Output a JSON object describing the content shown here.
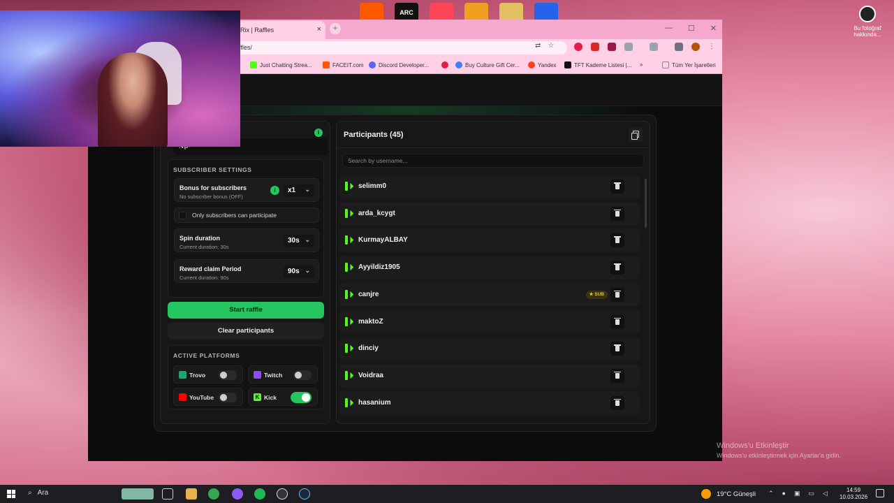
{
  "desktop": {
    "right_icon_label": "Bu fotoğraf hakkında...",
    "top_icons": [
      {
        "name": "fnatic-icon",
        "color": "#ff5900"
      },
      {
        "name": "arc-raiders-icon",
        "label": "ARC",
        "color": "#111111"
      },
      {
        "name": "valorant-icon",
        "color": "#fd4556"
      },
      {
        "name": "counter-strike-icon",
        "color": "#f0a020"
      },
      {
        "name": "game-icon",
        "color": "#e0c060"
      },
      {
        "name": "screenshot-tool-icon",
        "color": "#2563eb"
      }
    ],
    "watermark": {
      "line1": "Windows'u Etkinleştir",
      "line2": "Windows'u etkinleştirmek için Ayarlar'a gidin."
    }
  },
  "browser": {
    "tab_title": "Rix | Raffles",
    "address": "ffles/",
    "bookmarks": [
      {
        "label": "Just Chatting Strea...",
        "color": "#53fc18"
      },
      {
        "label": "FACEIT.com",
        "color": "#ff5500"
      },
      {
        "label": "Discord Developer...",
        "color": "#5865f2"
      },
      {
        "label": "",
        "color": "#e11d48"
      },
      {
        "label": "Buy Culture Gift Cer...",
        "color": "#3b82f6"
      },
      {
        "label": "Yandex",
        "color": "#fc3f1d"
      },
      {
        "label": "TFT Kademe Listesi |...",
        "color": "#111111"
      },
      {
        "label": "»",
        "color": ""
      },
      {
        "label": "Tüm Yer İşaretleri",
        "color": "#888888"
      }
    ]
  },
  "raffle": {
    "command_value": "!vp",
    "subscriber_settings": {
      "title": "SUBSCRIBER SETTINGS",
      "bonus": {
        "title": "Bonus for subscribers",
        "subtitle": "No subscriber bonus (OFF)",
        "value": "x1"
      },
      "only_subs_label": "Only subscribers can participate",
      "spin": {
        "title": "Spin duration",
        "subtitle": "Current duration: 30s",
        "value": "30s"
      },
      "claim": {
        "title": "Reward claim Period",
        "subtitle": "Current duration: 90s",
        "value": "90s"
      }
    },
    "start_label": "Start raffle",
    "clear_label": "Clear participants",
    "platforms": {
      "title": "ACTIVE PLATFORMS",
      "items": [
        {
          "name": "Trovo",
          "on": false,
          "color": "#1ba672"
        },
        {
          "name": "Twitch",
          "on": false,
          "color": "#9146ff"
        },
        {
          "name": "YouTube",
          "on": false,
          "color": "#ff0000"
        },
        {
          "name": "Kick",
          "on": true,
          "color": "#53fc18"
        }
      ]
    }
  },
  "participants": {
    "title": "Participants (45)",
    "search_placeholder": "Search by username...",
    "sub_badge": "SUB",
    "list": [
      {
        "name": "selimm0",
        "sub": false
      },
      {
        "name": "arda_kcygt",
        "sub": false
      },
      {
        "name": "KurmayALBAY",
        "sub": false
      },
      {
        "name": "Ayyildiz1905",
        "sub": false
      },
      {
        "name": "canjre",
        "sub": true
      },
      {
        "name": "maktoZ",
        "sub": false
      },
      {
        "name": "dinciy",
        "sub": false
      },
      {
        "name": "Voidraa",
        "sub": false
      },
      {
        "name": "hasanium",
        "sub": false
      }
    ]
  },
  "taskbar": {
    "search_label": "Ara",
    "weather": "19°C Güneşli",
    "time": "14:59",
    "date": "10.03.2026"
  },
  "colors": {
    "accent": "#22c55e",
    "kick": "#53fc18",
    "tab_bar": "#f7a8cf"
  }
}
